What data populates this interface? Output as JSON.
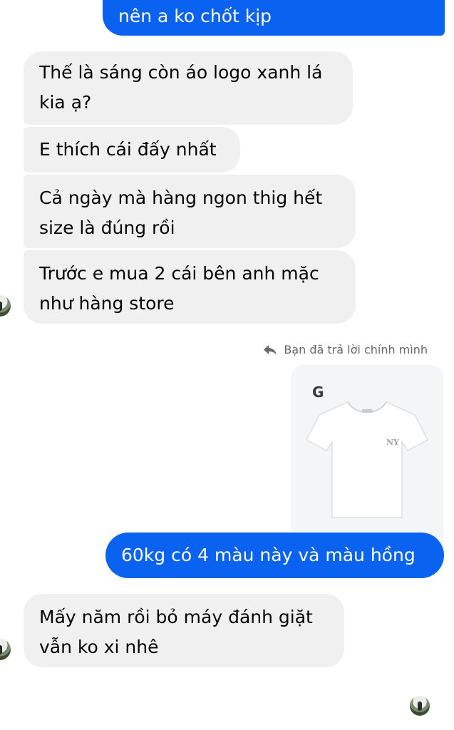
{
  "messages": [
    {
      "id": "m1",
      "text": "nên a ko chốt kịp",
      "direction": "outgoing"
    },
    {
      "id": "m2",
      "text": "Thế là sáng còn áo logo xanh lá kia ạ?",
      "direction": "incoming"
    },
    {
      "id": "m3",
      "text": "E thích cái đấy nhất",
      "direction": "incoming"
    },
    {
      "id": "m4",
      "text": "Cả ngày mà hàng ngon thig hết size là đúng rồi",
      "direction": "incoming"
    },
    {
      "id": "m5",
      "text": "Trước e mua 2 cái bên anh mặc như hàng store",
      "direction": "incoming"
    },
    {
      "id": "m6",
      "text": "60kg có 4 màu này và màu hồng",
      "direction": "outgoing"
    },
    {
      "id": "m7",
      "text": "Mấy năm rồi bỏ máy đánh giặt vẫn ko xi nhê",
      "direction": "incoming"
    }
  ],
  "reply_notice": {
    "text": "Bạn đã trả lời chính mình",
    "icon": "reply-arrow-icon"
  },
  "attachment": {
    "brand_letter": "G",
    "image": "white-tshirt-ny-logo",
    "logo_text": "NY"
  },
  "colors": {
    "outgoing_bubble": "#0a63f0",
    "incoming_bubble": "#f0f0f0",
    "meta_text": "#65676b"
  }
}
